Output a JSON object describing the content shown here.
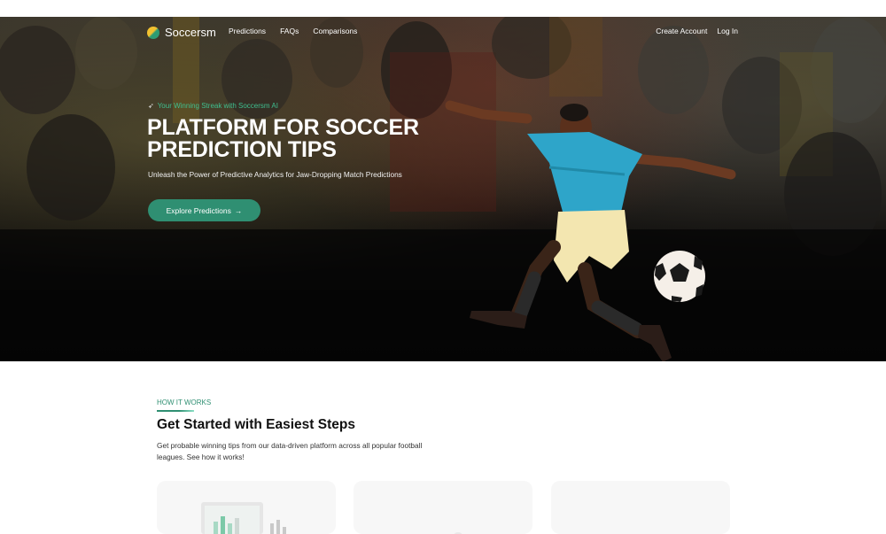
{
  "nav": {
    "brand": "Soccersm",
    "links": [
      "Predictions",
      "FAQs",
      "Comparisons"
    ],
    "create_account": "Create Account",
    "login": "Log In"
  },
  "hero": {
    "tagline": "Your Winning Streak with Soccersm AI",
    "title": "PLATFORM FOR SOCCER PREDICTION TIPS",
    "subtitle": "Unleash the Power of Predictive Analytics for Jaw-Dropping Match Predictions",
    "cta_label": "Explore Predictions",
    "cta_icon": "arrow-right-icon"
  },
  "how_it_works": {
    "label": "HOW IT WORKS",
    "title": "Get Started with Easiest Steps",
    "description": "Get probable winning tips from our data-driven platform across all popular football leagues. See how it works!"
  },
  "colors": {
    "accent": "#2f8f72",
    "accent_light": "#3fbf8f",
    "hero_bg": "#0a0a0a",
    "card_bg": "#f7f7f7"
  }
}
